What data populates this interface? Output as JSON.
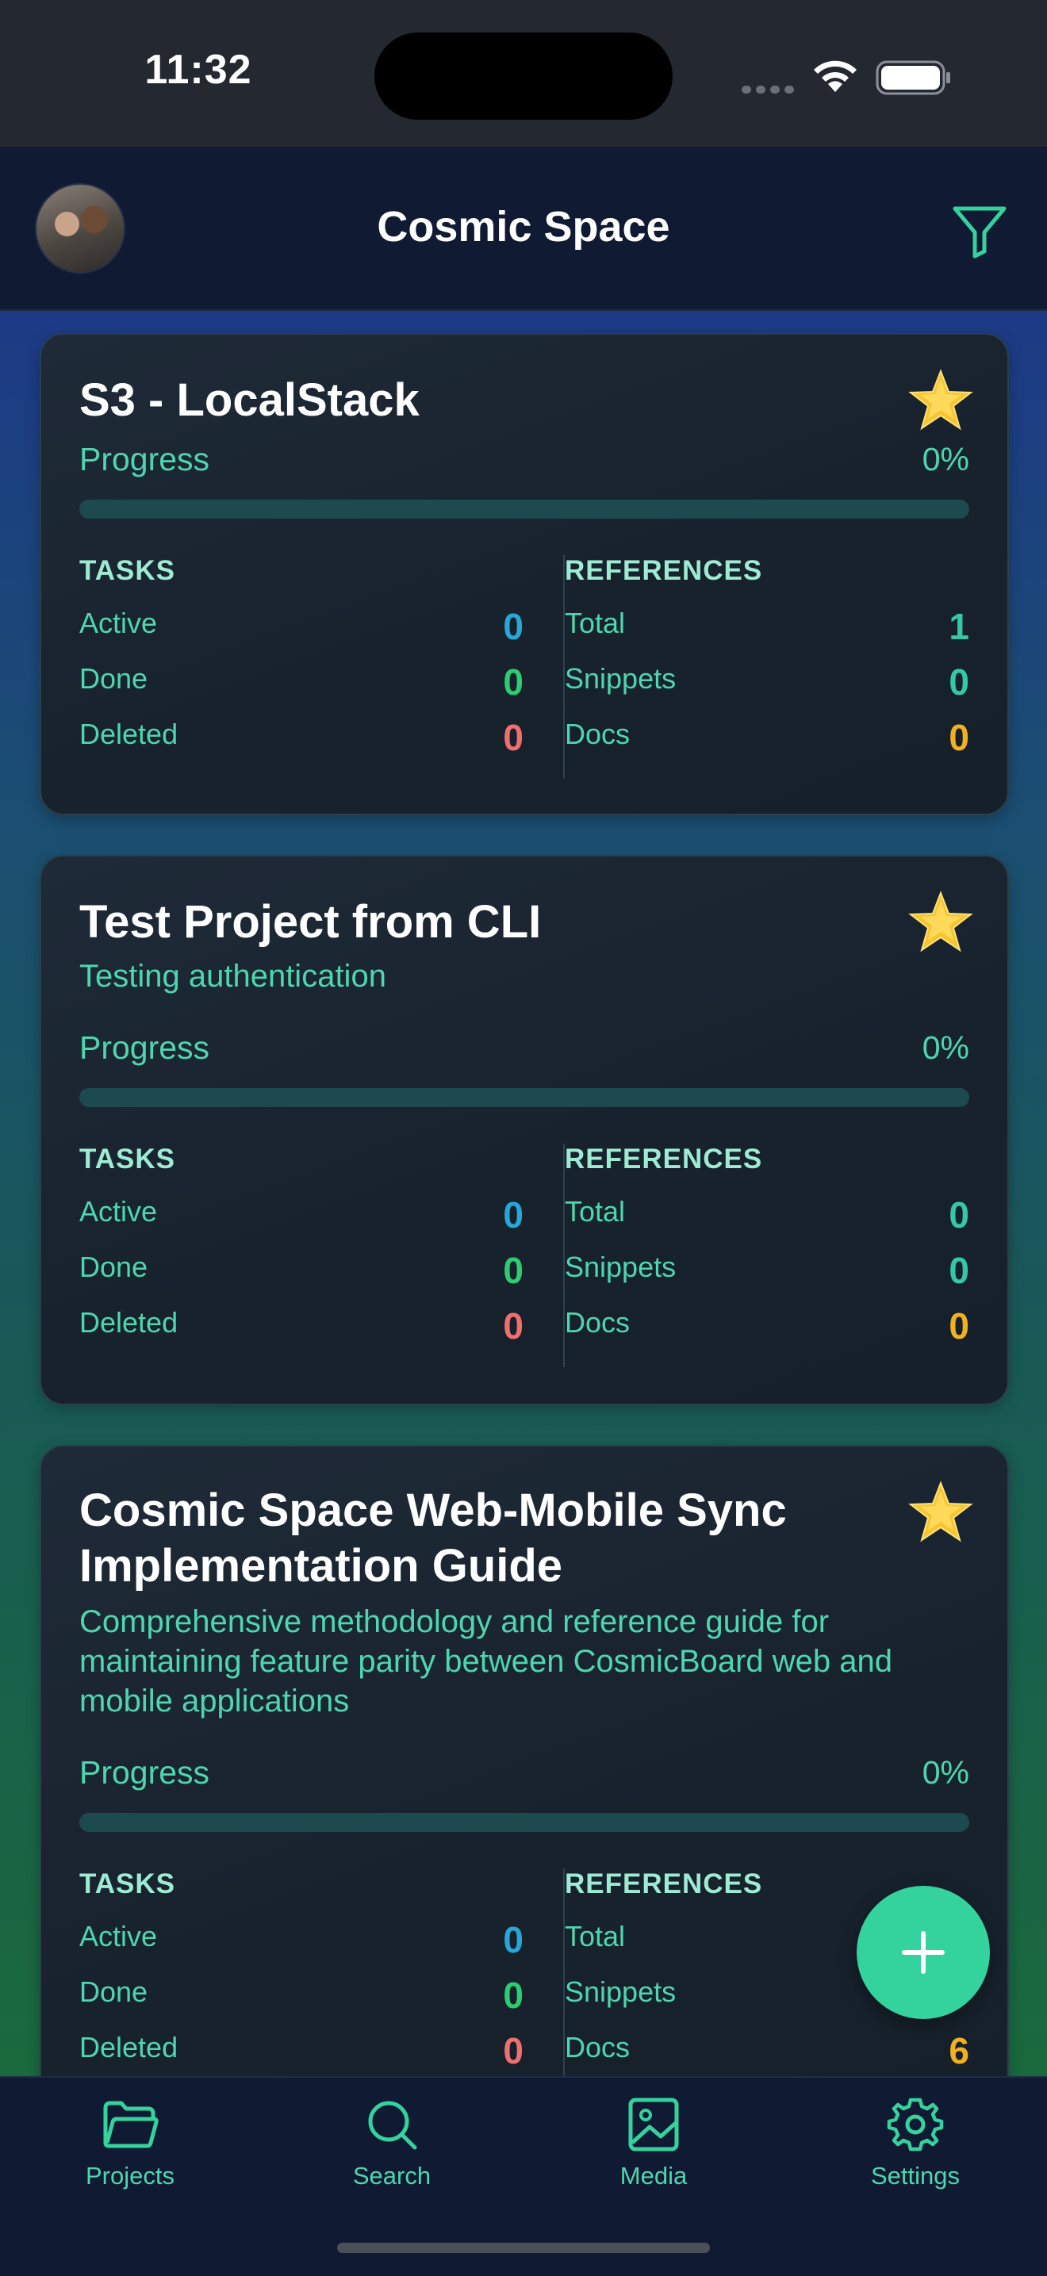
{
  "status_bar": {
    "time": "11:32"
  },
  "header": {
    "title": "Cosmic Space"
  },
  "labels": {
    "progress": "Progress",
    "tasks": "TASKS",
    "references": "REFERENCES",
    "active": "Active",
    "done": "Done",
    "deleted": "Deleted",
    "total": "Total",
    "snippets": "Snippets",
    "docs": "Docs"
  },
  "projects": [
    {
      "title": "S3 - LocalStack",
      "description": "",
      "progress_percent": 0,
      "progress_text": "0%",
      "tasks": {
        "active": "0",
        "done": "0",
        "deleted": "0"
      },
      "references": {
        "total": "1",
        "snippets": "0",
        "docs": "0"
      }
    },
    {
      "title": "Test Project from CLI",
      "description": "Testing authentication",
      "progress_percent": 0,
      "progress_text": "0%",
      "tasks": {
        "active": "0",
        "done": "0",
        "deleted": "0"
      },
      "references": {
        "total": "0",
        "snippets": "0",
        "docs": "0"
      }
    },
    {
      "title": "Cosmic Space Web-Mobile Sync Implementation Guide",
      "description": "Comprehensive methodology and reference guide for maintaining feature parity between CosmicBoard web and mobile applications",
      "progress_percent": 0,
      "progress_text": "0%",
      "tasks": {
        "active": "0",
        "done": "0",
        "deleted": "0"
      },
      "references": {
        "total": "",
        "snippets": "",
        "docs": "6"
      }
    }
  ],
  "tab_bar": {
    "tabs": [
      {
        "label": "Projects",
        "icon": "folder-icon"
      },
      {
        "label": "Search",
        "icon": "search-icon"
      },
      {
        "label": "Media",
        "icon": "image-icon"
      },
      {
        "label": "Settings",
        "icon": "gear-icon"
      }
    ]
  },
  "colors": {
    "accent": "#34d39e",
    "active": "#27a7d8",
    "done": "#2ecc71",
    "deleted": "#ef6f6f",
    "total": "#34c9a3",
    "docs": "#f0b020"
  }
}
